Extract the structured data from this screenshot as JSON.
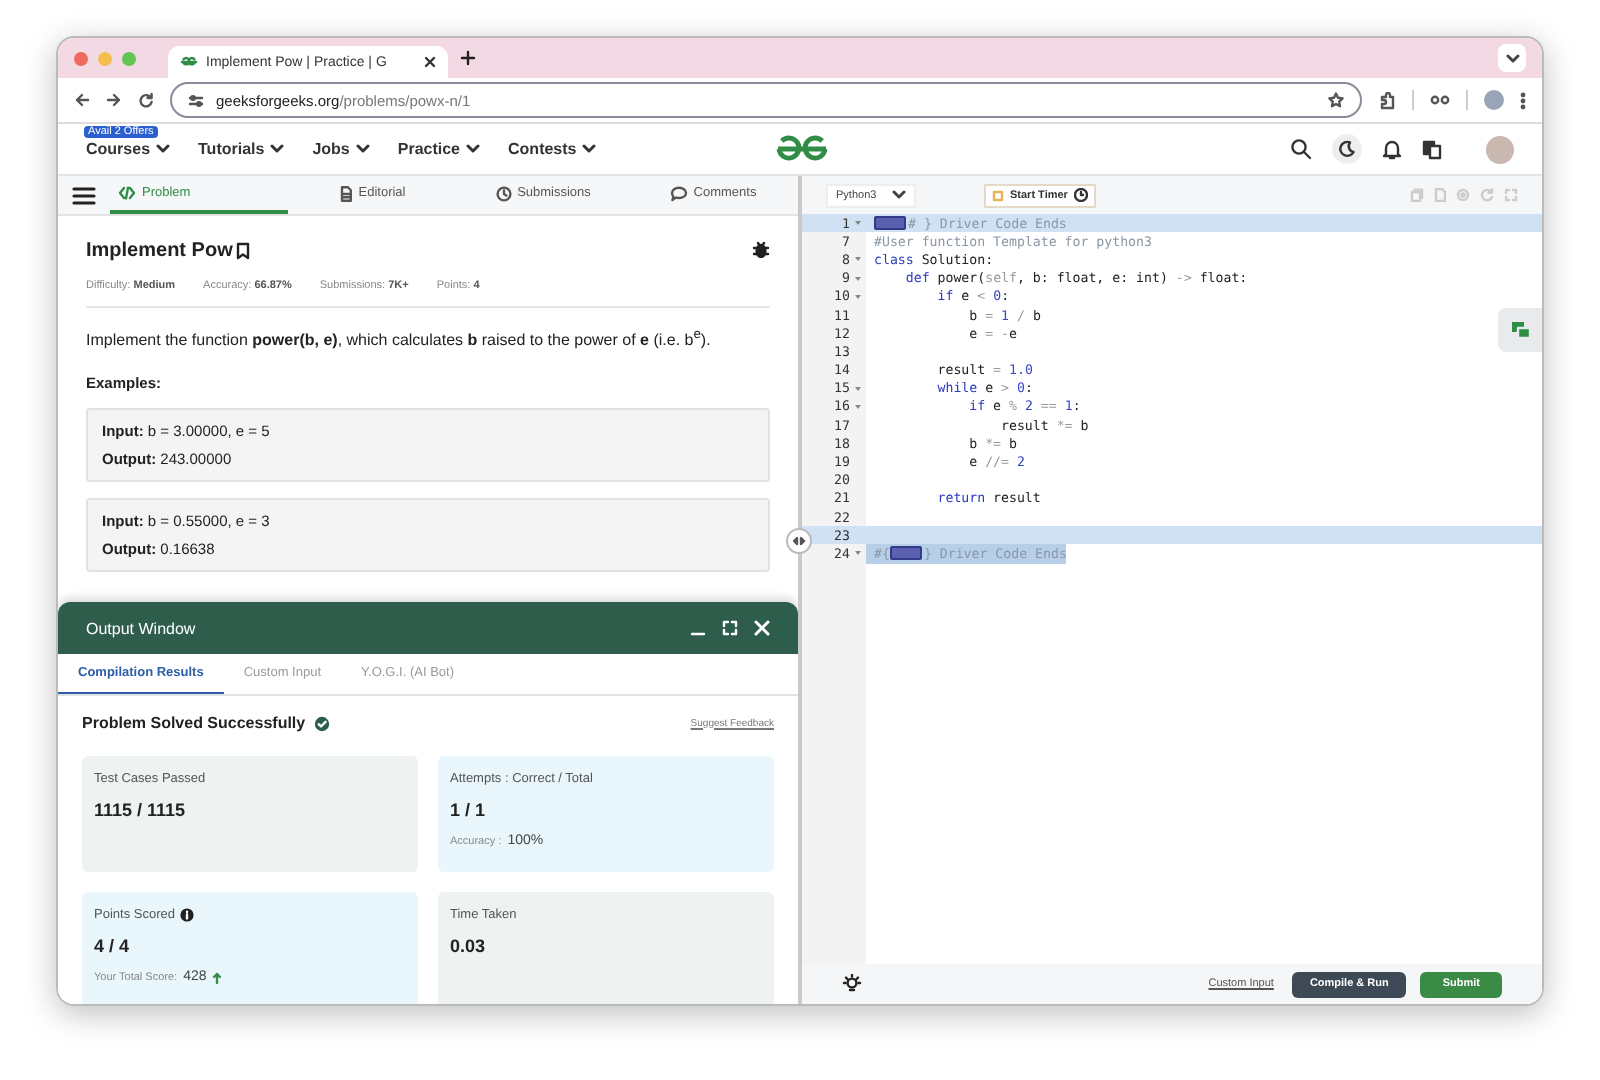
{
  "browser": {
    "tab_title": "Implement Pow | Practice | G",
    "url_host": "geeksforgeeks.org",
    "url_path": "/problems/powx-n/1"
  },
  "site_nav": {
    "offer_badge": "Avail 2 Offers",
    "menus": [
      "Courses",
      "Tutorials",
      "Jobs",
      "Practice",
      "Contests"
    ]
  },
  "problem_tabs": [
    {
      "label": "Problem",
      "selected": true
    },
    {
      "label": "Editorial",
      "selected": false
    },
    {
      "label": "Submissions",
      "selected": false
    },
    {
      "label": "Comments",
      "selected": false
    }
  ],
  "problem": {
    "title": "Implement Pow",
    "meta": [
      {
        "label": "Difficulty:",
        "value": "Medium"
      },
      {
        "label": "Accuracy:",
        "value": "66.87%"
      },
      {
        "label": "Submissions:",
        "value": "7K+"
      },
      {
        "label": "Points:",
        "value": "4"
      }
    ],
    "description": "Implement the function **power(b, e)**, which calculates **b** raised to the power of **e** (i.e. b$^{e}$).",
    "examples_heading": "Examples:",
    "examples": [
      {
        "input": "**Input:** b = 3.00000, e = 5",
        "output": "**Output:** 243.00000"
      },
      {
        "input": "**Input:** b = 0.55000, e = 3",
        "output": "**Output:** 0.16638"
      }
    ]
  },
  "output_window": {
    "title": "Output Window",
    "tabs": [
      {
        "label": "Compilation Results",
        "selected": true
      },
      {
        "label": "Custom Input",
        "selected": false
      },
      {
        "label": "Y.O.G.I. (AI Bot)",
        "selected": false
      }
    ],
    "status": "Problem Solved Successfully",
    "feedback_link": "Suggest Feedback",
    "cards": [
      {
        "label": "Test Cases Passed",
        "value": "1115 / 1115",
        "color": "#eef2f1",
        "info": false
      },
      {
        "label": "Attempts : Correct / Total",
        "value": "1 / 1",
        "color": "#e9f6fb",
        "info": false,
        "note_label": "Accuracy :",
        "note_value": "100%",
        "trending_up": false
      },
      {
        "label": "Points Scored",
        "value": "4 / 4",
        "color": "#e9f6fb",
        "info": true,
        "note_label": "Your Total Score:",
        "note_value": "428",
        "trending_up": true
      },
      {
        "label": "Time Taken",
        "value": "0.03",
        "color": "#eef2f1",
        "info": false
      }
    ]
  },
  "editor": {
    "language": "Python3",
    "timer_button": "Start Timer",
    "lines": [
      {
        "number": "1",
        "fold": true,
        "highlighted": true,
        "selected": false,
        "tokens": [
          {
            "kind": "fold-box"
          },
          {
            "kind": "comment",
            "text": "# } Driver Code Ends"
          }
        ]
      },
      {
        "number": "7",
        "fold": false,
        "highlighted": false,
        "selected": false,
        "tokens": [
          {
            "kind": "comment",
            "text": "#User function Template for python3"
          }
        ]
      },
      {
        "number": "8",
        "fold": true,
        "highlighted": false,
        "selected": false,
        "tokens": [
          {
            "kind": "keyword",
            "text": "class"
          },
          {
            "kind": "plain",
            "text": " Solution:"
          }
        ]
      },
      {
        "number": "9",
        "fold": true,
        "highlighted": false,
        "selected": false,
        "tokens": [
          {
            "kind": "keyword",
            "text": "    def"
          },
          {
            "kind": "plain",
            "text": " power("
          },
          {
            "kind": "operator",
            "text": "self"
          },
          {
            "kind": "plain",
            "text": ", b: float, e: int) "
          },
          {
            "kind": "operator",
            "text": "->"
          },
          {
            "kind": "plain",
            "text": " float:"
          }
        ]
      },
      {
        "number": "10",
        "fold": true,
        "highlighted": false,
        "selected": false,
        "tokens": [
          {
            "kind": "keyword",
            "text": "        if"
          },
          {
            "kind": "plain",
            "text": " e "
          },
          {
            "kind": "operator",
            "text": "<"
          },
          {
            "kind": "number",
            "text": " 0"
          },
          {
            "kind": "plain",
            "text": ":"
          }
        ]
      },
      {
        "number": "11",
        "fold": false,
        "highlighted": false,
        "selected": false,
        "tokens": [
          {
            "kind": "plain",
            "text": "            b "
          },
          {
            "kind": "operator",
            "text": "="
          },
          {
            "kind": "number",
            "text": " 1"
          },
          {
            "kind": "operator",
            "text": " /"
          },
          {
            "kind": "plain",
            "text": " b"
          }
        ]
      },
      {
        "number": "12",
        "fold": false,
        "highlighted": false,
        "selected": false,
        "tokens": [
          {
            "kind": "plain",
            "text": "            e "
          },
          {
            "kind": "operator",
            "text": "= -"
          },
          {
            "kind": "plain",
            "text": "e"
          }
        ]
      },
      {
        "number": "13",
        "fold": false,
        "highlighted": false,
        "selected": false
      },
      {
        "number": "14",
        "fold": false,
        "highlighted": false,
        "selected": false,
        "tokens": [
          {
            "kind": "plain",
            "text": "        result "
          },
          {
            "kind": "operator",
            "text": "="
          },
          {
            "kind": "number",
            "text": " 1.0"
          }
        ]
      },
      {
        "number": "15",
        "fold": true,
        "highlighted": false,
        "selected": false,
        "tokens": [
          {
            "kind": "keyword",
            "text": "        while"
          },
          {
            "kind": "plain",
            "text": " e "
          },
          {
            "kind": "operator",
            "text": ">"
          },
          {
            "kind": "number",
            "text": " 0"
          },
          {
            "kind": "plain",
            "text": ":"
          }
        ]
      },
      {
        "number": "16",
        "fold": true,
        "highlighted": false,
        "selected": false,
        "tokens": [
          {
            "kind": "keyword",
            "text": "            if"
          },
          {
            "kind": "plain",
            "text": " e "
          },
          {
            "kind": "operator",
            "text": "%"
          },
          {
            "kind": "number",
            "text": " 2"
          },
          {
            "kind": "operator",
            "text": " =="
          },
          {
            "kind": "number",
            "text": " 1"
          },
          {
            "kind": "plain",
            "text": ":"
          }
        ]
      },
      {
        "number": "17",
        "fold": false,
        "highlighted": false,
        "selected": false,
        "tokens": [
          {
            "kind": "plain",
            "text": "                result "
          },
          {
            "kind": "operator",
            "text": "*="
          },
          {
            "kind": "plain",
            "text": " b"
          }
        ]
      },
      {
        "number": "18",
        "fold": false,
        "highlighted": false,
        "selected": false,
        "tokens": [
          {
            "kind": "plain",
            "text": "            b "
          },
          {
            "kind": "operator",
            "text": "*="
          },
          {
            "kind": "plain",
            "text": " b"
          }
        ]
      },
      {
        "number": "19",
        "fold": false,
        "highlighted": false,
        "selected": false,
        "tokens": [
          {
            "kind": "plain",
            "text": "            e "
          },
          {
            "kind": "operator",
            "text": "//="
          },
          {
            "kind": "number",
            "text": " 2"
          }
        ]
      },
      {
        "number": "20",
        "fold": false,
        "highlighted": false,
        "selected": false
      },
      {
        "number": "21",
        "fold": false,
        "highlighted": false,
        "selected": false,
        "tokens": [
          {
            "kind": "keyword",
            "text": "        return"
          },
          {
            "kind": "plain",
            "text": " result"
          }
        ]
      },
      {
        "number": "22",
        "fold": false,
        "highlighted": false,
        "selected": false
      },
      {
        "number": "23",
        "fold": false,
        "highlighted": true,
        "selected": false
      },
      {
        "number": "24",
        "fold": true,
        "highlighted": false,
        "selected": true,
        "tokens": [
          {
            "kind": "comment",
            "text": "#{"
          },
          {
            "kind": "fold-box"
          },
          {
            "kind": "comment",
            "text": "} Driver Code Ends"
          }
        ]
      }
    ],
    "custom_input_link": "Custom Input",
    "compile_button": "Compile & Run",
    "submit_button": "Submit"
  }
}
